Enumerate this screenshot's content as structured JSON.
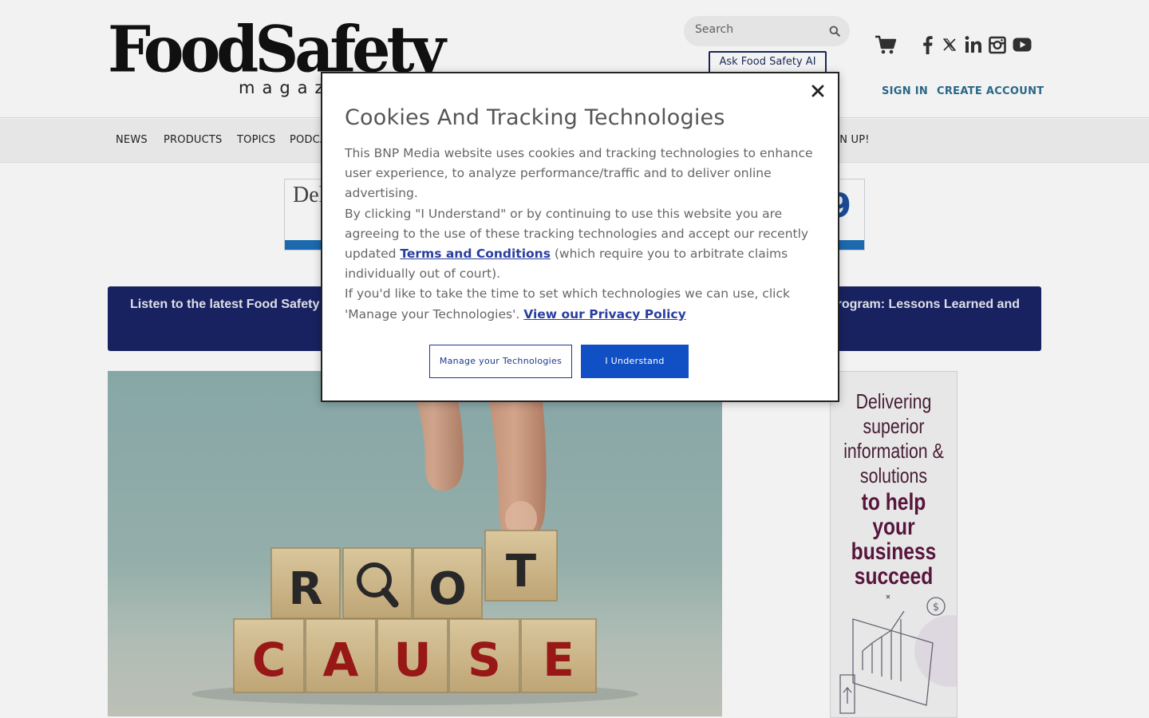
{
  "header": {
    "logo_main": "FoodSafety",
    "logo_sub": "magazine",
    "search_placeholder": "Search",
    "ask_button": "Ask Food Safety AI",
    "sign_in": "SIGN IN",
    "create_account": "CREATE ACCOUNT",
    "social": [
      "facebook-icon",
      "x-icon",
      "linkedin-icon",
      "instagram-icon",
      "youtube-icon"
    ]
  },
  "nav": {
    "items": [
      "NEWS",
      "PRODUCTS",
      "TOPICS",
      "PODCA",
      "GN UP!"
    ]
  },
  "leader_ad": {
    "text": "Deli",
    "emblem": "9"
  },
  "podcast_banner": {
    "left_text": "Listen to the latest Food Safety",
    "right_text": "rogram: Lessons Learned and"
  },
  "hero": {
    "top_row": [
      "R",
      "O",
      "T"
    ],
    "bottom_row": [
      "C",
      "A",
      "U",
      "S",
      "E"
    ]
  },
  "side_ad": {
    "line1": "Delivering superior information & solutions",
    "line2": "to help your business succeed"
  },
  "cookie_modal": {
    "title": "Cookies And Tracking Technologies",
    "para1": "This BNP Media website uses cookies and tracking technologies to enhance user experience, to analyze performance/traffic and to deliver online advertising.",
    "para2_before": "By clicking \"I Understand\" or by continuing to use this website you are agreeing to the use of these tracking technologies and accept our recently updated ",
    "para2_link": "Terms and Conditions",
    "para2_after": " (which require you to arbitrate claims individually out of court).",
    "para3": "If you'd like to take the time to set which technologies we can use, click 'Manage your Technologies'.",
    "privacy_link": "View our Privacy Policy",
    "manage_button": "Manage your Technologies",
    "accept_button": "I Understand"
  },
  "colors": {
    "podcast_bg": "#1b2466",
    "link_blue": "#2a3ea1",
    "accept_blue": "#1150c4",
    "auth_teal": "#2c6e8f",
    "word_red": "#a11a1a"
  }
}
